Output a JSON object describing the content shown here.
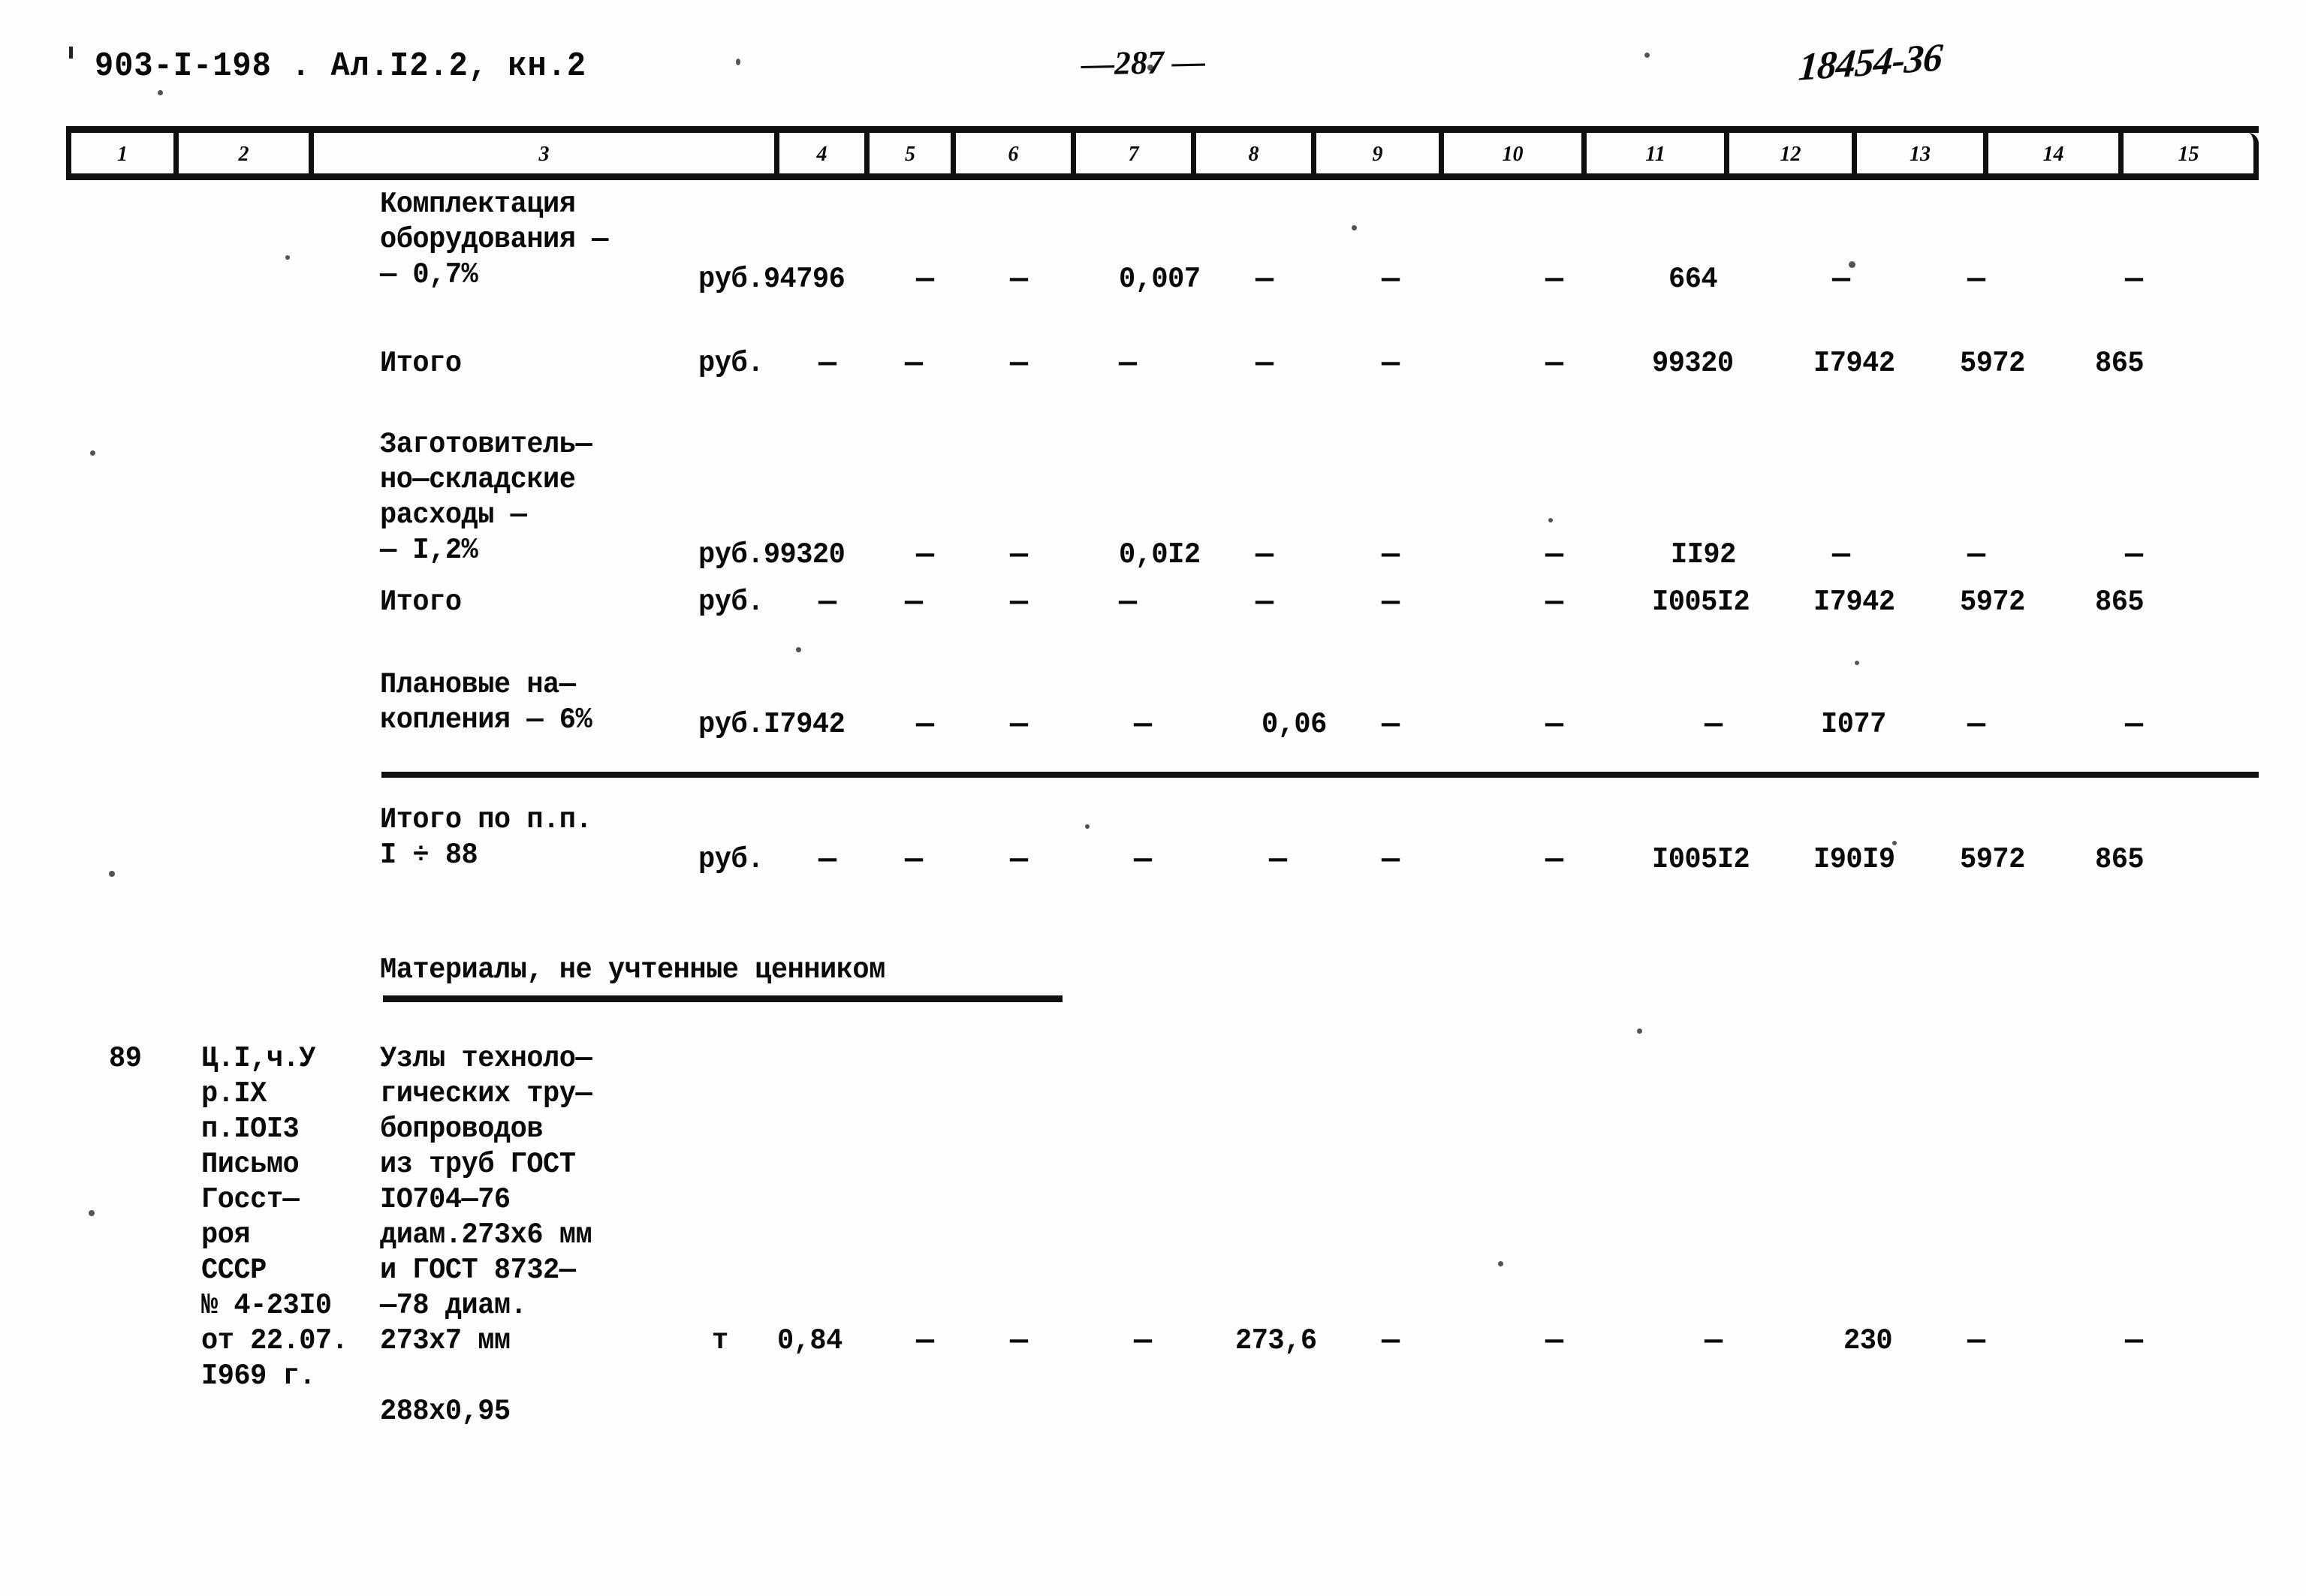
{
  "header": {
    "doc_code": "903-I-198 . Ал.I2.2, кн.2",
    "page_number": "—287 —",
    "stamp": "18454-36"
  },
  "table": {
    "column_numbers": [
      "1",
      "2",
      "3",
      "4",
      "5",
      "6",
      "7",
      "8",
      "9",
      "10",
      "11",
      "12",
      "13",
      "14",
      "15"
    ],
    "dash": "—",
    "rows": [
      {
        "id": "komplektaciya",
        "desc_lines": [
          "Комплектация",
          "оборудования —",
          "— 0,7%"
        ],
        "unit": "руб.94796",
        "c5": "—",
        "c6": "—",
        "c7": "",
        "c8": "0,007",
        "c9": "—",
        "c10": "—",
        "c11": "—",
        "c12": "664",
        "c13": "—",
        "c14": "—",
        "c15": "—"
      },
      {
        "id": "itogo-1",
        "desc_lines": [
          "Итого"
        ],
        "unit": "руб.",
        "c4d": "—",
        "c5": "—",
        "c6": "—",
        "c7": "—",
        "c8": "—",
        "c9": "—",
        "c10": "—",
        "c11": "—",
        "c12": "99320",
        "c13": "I7942",
        "c14": "5972",
        "c15": "865"
      },
      {
        "id": "zagotovitelno-skladskie",
        "desc_lines": [
          "Заготовитель—",
          "но—складские",
          "расходы —",
          "— I,2%"
        ],
        "unit": "руб.99320",
        "c5": "—",
        "c6": "—",
        "c7": "",
        "c8": "0,0I2",
        "c9": "—",
        "c10": "—",
        "c11": "—",
        "c12": "II92",
        "c13": "—",
        "c14": "—",
        "c15": "—"
      },
      {
        "id": "itogo-2",
        "desc_lines": [
          "Итого"
        ],
        "unit": "руб.",
        "c4d": "—",
        "c5": "—",
        "c6": "—",
        "c7": "—",
        "c8": "—",
        "c9": "—",
        "c10": "—",
        "c11": "—",
        "c12": "I005I2",
        "c13": "I7942",
        "c14": "5972",
        "c15": "865"
      },
      {
        "id": "planovye-nakopleniya",
        "desc_lines": [
          "Плановые на—",
          "копления — 6%"
        ],
        "unit": "руб.I7942",
        "c5": "—",
        "c6": "—",
        "c7": "—",
        "c8": "—",
        "c9": "0,06",
        "c10": "—",
        "c11": "—",
        "c12": "—",
        "c13": "I077",
        "c14": "—",
        "c15": "—"
      },
      {
        "id": "itogo-po-pp",
        "desc_lines": [
          "Итого по п.п.",
          "I ÷ 88"
        ],
        "unit": "руб.",
        "c4d": "—",
        "c5": "—",
        "c6": "—",
        "c7": "—",
        "c8": "—",
        "c9": "—",
        "c10": "—",
        "c11": "—",
        "c12": "I005I2",
        "c13": "I90I9",
        "c14": "5972",
        "c15": "865"
      }
    ],
    "materials_caption": "Материалы, не учтенные ценником",
    "item_89": {
      "number": "89",
      "ref_lines": [
        "Ц.I,ч.У",
        "р.IХ",
        "п.IOI3",
        "Письмо",
        "Госст—",
        "роя",
        "СССР",
        "№ 4-23I0",
        "от 22.07.",
        "I969 г."
      ],
      "desc_lines": [
        "Узлы техноло—",
        "гических тру—",
        "бопроводов",
        "из труб ГОСТ",
        "IO704—76",
        "диам.273х6 мм",
        "и ГОСТ 8732—",
        "—78 диам.",
        "273х7 мм"
      ],
      "desc_extra": "288х0,95",
      "unit": "т",
      "c5": "0,84",
      "c6": "—",
      "c7": "—",
      "c8": "—",
      "c9": "273,6",
      "c10": "—",
      "c11": "—",
      "c12": "—",
      "c13": "230",
      "c14": "—",
      "c15": "—"
    }
  }
}
